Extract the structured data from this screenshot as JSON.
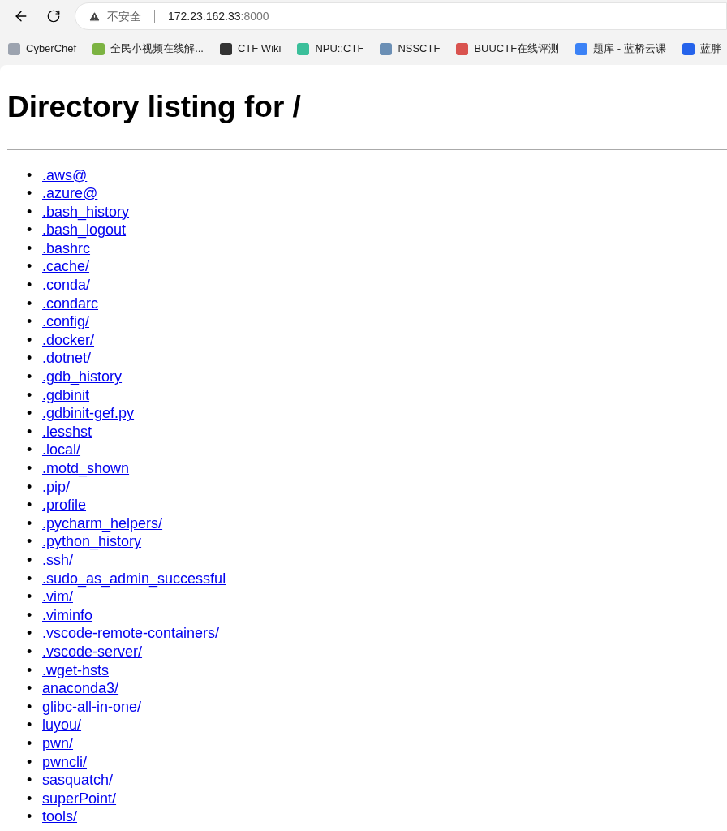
{
  "browser": {
    "security_label": "不安全",
    "url_host": "172.23.162.33",
    "url_port": ":8000"
  },
  "bookmarks": [
    {
      "label": "CyberChef",
      "color": "#9ca3af"
    },
    {
      "label": "全民小视频在线解...",
      "color": "#7cb342"
    },
    {
      "label": "CTF Wiki",
      "color": "#333333"
    },
    {
      "label": "NPU::CTF",
      "color": "#3bbf9a"
    },
    {
      "label": "NSSCTF",
      "color": "#6b8fb5"
    },
    {
      "label": "BUUCTF在线评测",
      "color": "#d9534f"
    },
    {
      "label": "题库 - 蓝桥云课",
      "color": "#3b82f6"
    },
    {
      "label": "蓝胖",
      "color": "#2563eb"
    }
  ],
  "page": {
    "title": "Directory listing for /",
    "marker": "•",
    "entries": [
      ".aws@",
      ".azure@",
      ".bash_history",
      ".bash_logout",
      ".bashrc",
      ".cache/",
      ".conda/",
      ".condarc",
      ".config/",
      ".docker/",
      ".dotnet/",
      ".gdb_history",
      ".gdbinit",
      ".gdbinit-gef.py",
      ".lesshst",
      ".local/",
      ".motd_shown",
      ".pip/",
      ".profile",
      ".pycharm_helpers/",
      ".python_history",
      ".ssh/",
      ".sudo_as_admin_successful",
      ".vim/",
      ".viminfo",
      ".vscode-remote-containers/",
      ".vscode-server/",
      ".wget-hsts",
      "anaconda3/",
      "glibc-all-in-one/",
      "luyou/",
      "pwn/",
      "pwncli/",
      "sasquatch/",
      "superPoint/",
      "tools/"
    ]
  }
}
